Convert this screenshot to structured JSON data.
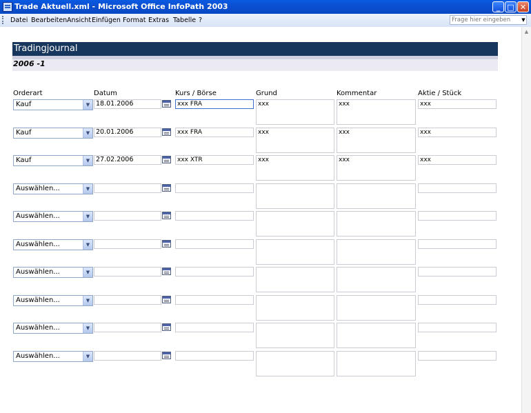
{
  "window": {
    "title": "Trade Aktuell.xml - Microsoft Office InfoPath 2003"
  },
  "menu": {
    "items": [
      "Datei",
      "Bearbeiten",
      "Ansicht",
      "Einfügen",
      "Format",
      "Extras",
      "Tabelle",
      "?"
    ],
    "help_placeholder": "Frage hier eingeben"
  },
  "form": {
    "title": "Tradingjournal",
    "subtitle": "2006 -1",
    "columns": [
      "Orderart",
      "Datum",
      "Kurs / Börse",
      "Grund",
      "Kommentar",
      "Aktie / Stück"
    ],
    "rows": [
      {
        "orderart": "Kauf",
        "datum": "18.01.2006",
        "kurs": "xxx FRA",
        "grund": "xxx",
        "kommentar": "xxx",
        "aktie": "xxx"
      },
      {
        "orderart": "Kauf",
        "datum": "20.01.2006",
        "kurs": "xxx FRA",
        "grund": "xxx",
        "kommentar": "xxx",
        "aktie": "xxx"
      },
      {
        "orderart": "Kauf",
        "datum": "27.02.2006",
        "kurs": "xxx XTR",
        "grund": "xxx",
        "kommentar": "xxx",
        "aktie": "xxx"
      },
      {
        "orderart": "Auswählen...",
        "datum": "",
        "kurs": "",
        "grund": "",
        "kommentar": "",
        "aktie": ""
      },
      {
        "orderart": "Auswählen...",
        "datum": "",
        "kurs": "",
        "grund": "",
        "kommentar": "",
        "aktie": ""
      },
      {
        "orderart": "Auswählen...",
        "datum": "",
        "kurs": "",
        "grund": "",
        "kommentar": "",
        "aktie": ""
      },
      {
        "orderart": "Auswählen...",
        "datum": "",
        "kurs": "",
        "grund": "",
        "kommentar": "",
        "aktie": ""
      },
      {
        "orderart": "Auswählen...",
        "datum": "",
        "kurs": "",
        "grund": "",
        "kommentar": "",
        "aktie": ""
      },
      {
        "orderart": "Auswählen...",
        "datum": "",
        "kurs": "",
        "grund": "",
        "kommentar": "",
        "aktie": ""
      },
      {
        "orderart": "Auswählen...",
        "datum": "",
        "kurs": "",
        "grund": "",
        "kommentar": "",
        "aktie": ""
      }
    ]
  },
  "icons": {
    "app": "infopath-icon",
    "minimize": "minimize-icon",
    "maximize": "maximize-icon",
    "close": "close-icon",
    "calendar": "calendar-icon",
    "dropdown": "chevron-down-icon"
  },
  "colors": {
    "header_band": "#17365d",
    "subheader_band": "#ebe9f2",
    "titlebar": "#0b4fd0"
  }
}
